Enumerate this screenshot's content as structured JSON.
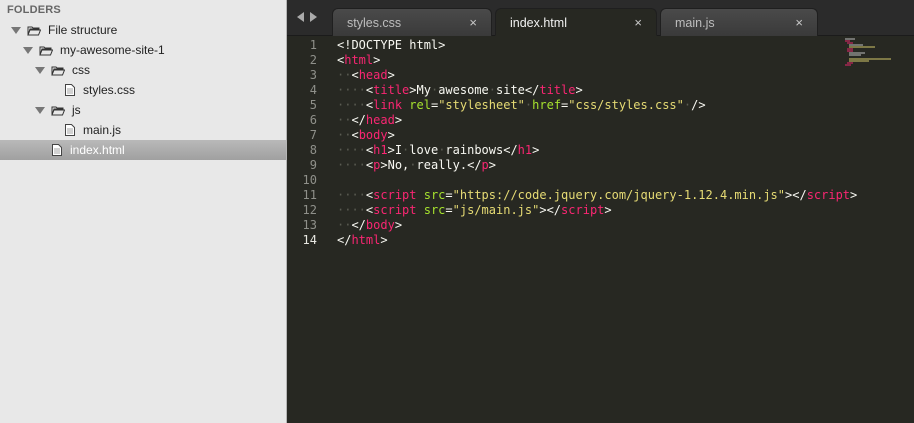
{
  "sidebar": {
    "header": "FOLDERS",
    "items": [
      {
        "label": "File structure",
        "type": "folder",
        "level": 0
      },
      {
        "label": "my-awesome-site-1",
        "type": "folder",
        "level": 1
      },
      {
        "label": "css",
        "type": "folder",
        "level": 2
      },
      {
        "label": "styles.css",
        "type": "file",
        "level": 3
      },
      {
        "label": "js",
        "type": "folder",
        "level": 2
      },
      {
        "label": "main.js",
        "type": "file",
        "level": 3
      },
      {
        "label": "index.html",
        "type": "file",
        "level": 2,
        "selected": true
      }
    ]
  },
  "tabs": [
    {
      "label": "styles.css",
      "close": "×",
      "active": false
    },
    {
      "label": "index.html",
      "close": "×",
      "active": true
    },
    {
      "label": "main.js",
      "close": "×",
      "active": false
    }
  ],
  "editor": {
    "current_line": 14,
    "line_numbers": [
      "1",
      "2",
      "3",
      "4",
      "5",
      "6",
      "7",
      "8",
      "9",
      "10",
      "11",
      "12",
      "13",
      "14"
    ],
    "lines": [
      [
        {
          "c": "d",
          "t": "<!DOCTYPE html>"
        }
      ],
      [
        {
          "c": "d",
          "t": "<"
        },
        {
          "c": "t",
          "t": "html"
        },
        {
          "c": "d",
          "t": ">"
        }
      ],
      [
        {
          "c": "ws",
          "t": "··"
        },
        {
          "c": "d",
          "t": "<"
        },
        {
          "c": "t",
          "t": "head"
        },
        {
          "c": "d",
          "t": ">"
        }
      ],
      [
        {
          "c": "ws",
          "t": "····"
        },
        {
          "c": "d",
          "t": "<"
        },
        {
          "c": "t",
          "t": "title"
        },
        {
          "c": "d",
          "t": ">My"
        },
        {
          "c": "ws",
          "t": "·"
        },
        {
          "c": "d",
          "t": "awesome"
        },
        {
          "c": "ws",
          "t": "·"
        },
        {
          "c": "d",
          "t": "site</"
        },
        {
          "c": "t",
          "t": "title"
        },
        {
          "c": "d",
          "t": ">"
        }
      ],
      [
        {
          "c": "ws",
          "t": "····"
        },
        {
          "c": "d",
          "t": "<"
        },
        {
          "c": "t",
          "t": "link"
        },
        {
          "c": "d",
          "t": " "
        },
        {
          "c": "a",
          "t": "rel"
        },
        {
          "c": "d",
          "t": "="
        },
        {
          "c": "s",
          "t": "\"stylesheet\""
        },
        {
          "c": "ws",
          "t": "·"
        },
        {
          "c": "a",
          "t": "href"
        },
        {
          "c": "d",
          "t": "="
        },
        {
          "c": "s",
          "t": "\"css/styles.css\""
        },
        {
          "c": "ws",
          "t": "·"
        },
        {
          "c": "d",
          "t": "/>"
        }
      ],
      [
        {
          "c": "ws",
          "t": "··"
        },
        {
          "c": "d",
          "t": "</"
        },
        {
          "c": "t",
          "t": "head"
        },
        {
          "c": "d",
          "t": ">"
        }
      ],
      [
        {
          "c": "ws",
          "t": "··"
        },
        {
          "c": "d",
          "t": "<"
        },
        {
          "c": "t",
          "t": "body"
        },
        {
          "c": "d",
          "t": ">"
        }
      ],
      [
        {
          "c": "ws",
          "t": "····"
        },
        {
          "c": "d",
          "t": "<"
        },
        {
          "c": "t",
          "t": "h1"
        },
        {
          "c": "d",
          "t": ">I"
        },
        {
          "c": "ws",
          "t": "·"
        },
        {
          "c": "d",
          "t": "love"
        },
        {
          "c": "ws",
          "t": "·"
        },
        {
          "c": "d",
          "t": "rainbows</"
        },
        {
          "c": "t",
          "t": "h1"
        },
        {
          "c": "d",
          "t": ">"
        }
      ],
      [
        {
          "c": "ws",
          "t": "····"
        },
        {
          "c": "d",
          "t": "<"
        },
        {
          "c": "t",
          "t": "p"
        },
        {
          "c": "d",
          "t": ">No,"
        },
        {
          "c": "ws",
          "t": "·"
        },
        {
          "c": "d",
          "t": "really.</"
        },
        {
          "c": "t",
          "t": "p"
        },
        {
          "c": "d",
          "t": ">"
        }
      ],
      [],
      [
        {
          "c": "ws",
          "t": "····"
        },
        {
          "c": "d",
          "t": "<"
        },
        {
          "c": "t",
          "t": "script"
        },
        {
          "c": "d",
          "t": " "
        },
        {
          "c": "a",
          "t": "src"
        },
        {
          "c": "d",
          "t": "="
        },
        {
          "c": "s",
          "t": "\"https://code.jquery.com/jquery-1.12.4.min.js\""
        },
        {
          "c": "d",
          "t": "></"
        },
        {
          "c": "t",
          "t": "script"
        },
        {
          "c": "d",
          "t": ">"
        }
      ],
      [
        {
          "c": "ws",
          "t": "····"
        },
        {
          "c": "d",
          "t": "<"
        },
        {
          "c": "t",
          "t": "script"
        },
        {
          "c": "d",
          "t": " "
        },
        {
          "c": "a",
          "t": "src"
        },
        {
          "c": "d",
          "t": "="
        },
        {
          "c": "s",
          "t": "\"js/main.js\""
        },
        {
          "c": "d",
          "t": "></"
        },
        {
          "c": "t",
          "t": "script"
        },
        {
          "c": "d",
          "t": ">"
        }
      ],
      [
        {
          "c": "ws",
          "t": "··"
        },
        {
          "c": "d",
          "t": "</"
        },
        {
          "c": "t",
          "t": "body"
        },
        {
          "c": "d",
          "t": ">"
        }
      ],
      [
        {
          "c": "d",
          "t": "</"
        },
        {
          "c": "t",
          "t": "html"
        },
        {
          "c": "d",
          "t": ">"
        }
      ]
    ]
  }
}
